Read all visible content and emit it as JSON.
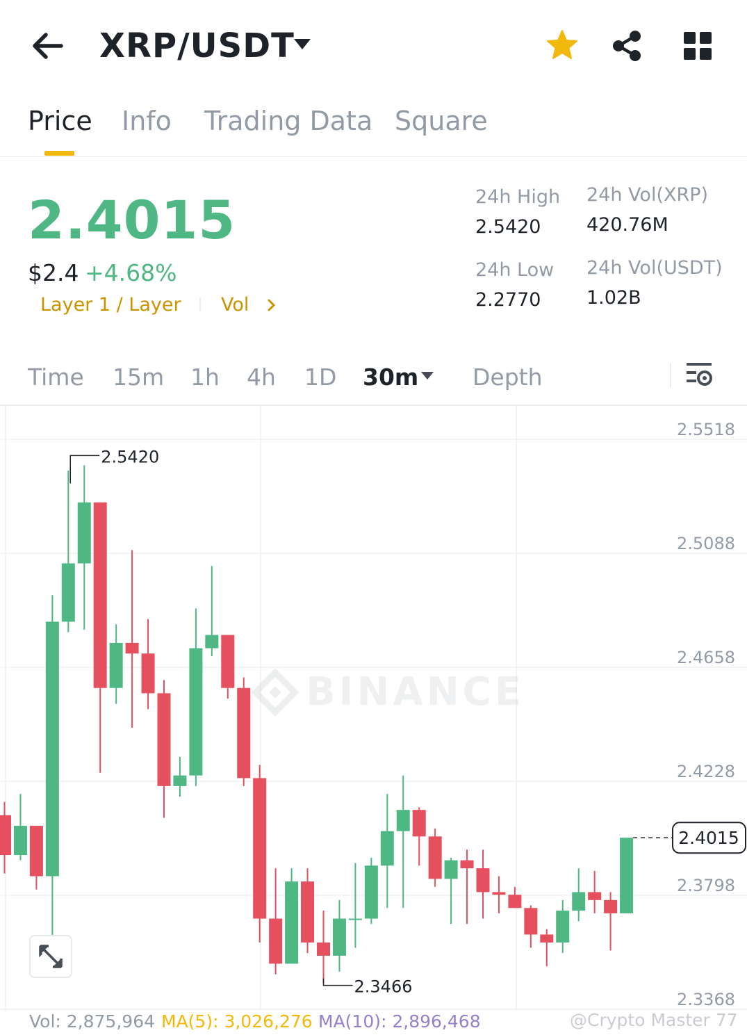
{
  "header": {
    "pair": "XRP/USDT",
    "icons": [
      "back-arrow-icon",
      "caret-down-icon",
      "star-icon",
      "share-icon",
      "grid-icon"
    ],
    "star_color": "#f0b90b"
  },
  "tabs": [
    {
      "label": "Price",
      "active": true
    },
    {
      "label": "Info",
      "active": false
    },
    {
      "label": "Trading Data",
      "active": false
    },
    {
      "label": "Square",
      "active": false
    }
  ],
  "price": {
    "last": "2.4015",
    "usd": "$2.4",
    "change": "+4.68%",
    "tag_layer": "Layer 1 / Layer",
    "tag_vol": "Vol",
    "up_color": "#4fb783",
    "down_color": "#e5505f",
    "tag_color": "#c99400"
  },
  "stats": {
    "high_label": "24h High",
    "high": "2.5420",
    "low_label": "24h Low",
    "low": "2.2770",
    "vol_xrp_label": "24h Vol(XRP)",
    "vol_xrp": "420.76M",
    "vol_usdt_label": "24h Vol(USDT)",
    "vol_usdt": "1.02B"
  },
  "intervals": [
    {
      "label": "Time",
      "active": false
    },
    {
      "label": "15m",
      "active": false
    },
    {
      "label": "1h",
      "active": false
    },
    {
      "label": "4h",
      "active": false
    },
    {
      "label": "1D",
      "active": false
    },
    {
      "label": "30m",
      "active": true
    },
    {
      "label": "Depth",
      "active": false
    }
  ],
  "chart_data": {
    "type": "candlestick",
    "y_ticks": [
      "2.5518",
      "2.5088",
      "2.4658",
      "2.4228",
      "2.3798",
      "2.3368"
    ],
    "ylim": [
      2.3368,
      2.5518
    ],
    "current_price": "2.4015",
    "annotation_high": "2.5420",
    "annotation_low": "2.3466",
    "watermark": "BINANCE",
    "candles": [
      {
        "o": 2.41,
        "h": 2.415,
        "l": 2.388,
        "c": 2.395
      },
      {
        "o": 2.395,
        "h": 2.418,
        "l": 2.393,
        "c": 2.406
      },
      {
        "o": 2.406,
        "h": 2.406,
        "l": 2.382,
        "c": 2.387
      },
      {
        "o": 2.387,
        "h": 2.493,
        "l": 2.357,
        "c": 2.483
      },
      {
        "o": 2.483,
        "h": 2.54,
        "l": 2.479,
        "c": 2.505
      },
      {
        "o": 2.505,
        "h": 2.542,
        "l": 2.48,
        "c": 2.528
      },
      {
        "o": 2.528,
        "h": 2.528,
        "l": 2.426,
        "c": 2.458
      },
      {
        "o": 2.458,
        "h": 2.482,
        "l": 2.452,
        "c": 2.475
      },
      {
        "o": 2.475,
        "h": 2.51,
        "l": 2.443,
        "c": 2.471
      },
      {
        "o": 2.471,
        "h": 2.484,
        "l": 2.45,
        "c": 2.456
      },
      {
        "o": 2.456,
        "h": 2.461,
        "l": 2.409,
        "c": 2.421
      },
      {
        "o": 2.421,
        "h": 2.432,
        "l": 2.417,
        "c": 2.425
      },
      {
        "o": 2.425,
        "h": 2.488,
        "l": 2.421,
        "c": 2.473
      },
      {
        "o": 2.473,
        "h": 2.504,
        "l": 2.47,
        "c": 2.478
      },
      {
        "o": 2.478,
        "h": 2.478,
        "l": 2.454,
        "c": 2.458
      },
      {
        "o": 2.458,
        "h": 2.462,
        "l": 2.421,
        "c": 2.424
      },
      {
        "o": 2.424,
        "h": 2.429,
        "l": 2.362,
        "c": 2.371
      },
      {
        "o": 2.371,
        "h": 2.39,
        "l": 2.35,
        "c": 2.354
      },
      {
        "o": 2.354,
        "h": 2.39,
        "l": 2.354,
        "c": 2.385
      },
      {
        "o": 2.385,
        "h": 2.39,
        "l": 2.358,
        "c": 2.362
      },
      {
        "o": 2.362,
        "h": 2.374,
        "l": 2.3466,
        "c": 2.357
      },
      {
        "o": 2.357,
        "h": 2.378,
        "l": 2.351,
        "c": 2.371
      },
      {
        "o": 2.371,
        "h": 2.392,
        "l": 2.36,
        "c": 2.371
      },
      {
        "o": 2.371,
        "h": 2.394,
        "l": 2.369,
        "c": 2.391
      },
      {
        "o": 2.391,
        "h": 2.418,
        "l": 2.375,
        "c": 2.404
      },
      {
        "o": 2.404,
        "h": 2.425,
        "l": 2.375,
        "c": 2.412
      },
      {
        "o": 2.412,
        "h": 2.413,
        "l": 2.391,
        "c": 2.402
      },
      {
        "o": 2.402,
        "h": 2.405,
        "l": 2.383,
        "c": 2.386
      },
      {
        "o": 2.386,
        "h": 2.394,
        "l": 2.369,
        "c": 2.393
      },
      {
        "o": 2.393,
        "h": 2.397,
        "l": 2.369,
        "c": 2.39
      },
      {
        "o": 2.39,
        "h": 2.397,
        "l": 2.371,
        "c": 2.381
      },
      {
        "o": 2.381,
        "h": 2.387,
        "l": 2.373,
        "c": 2.38
      },
      {
        "o": 2.38,
        "h": 2.383,
        "l": 2.375,
        "c": 2.375
      },
      {
        "o": 2.375,
        "h": 2.376,
        "l": 2.36,
        "c": 2.365
      },
      {
        "o": 2.365,
        "h": 2.367,
        "l": 2.353,
        "c": 2.362
      },
      {
        "o": 2.362,
        "h": 2.378,
        "l": 2.358,
        "c": 2.374
      },
      {
        "o": 2.374,
        "h": 2.39,
        "l": 2.37,
        "c": 2.381
      },
      {
        "o": 2.381,
        "h": 2.389,
        "l": 2.373,
        "c": 2.378
      },
      {
        "o": 2.378,
        "h": 2.381,
        "l": 2.359,
        "c": 2.373
      },
      {
        "o": 2.373,
        "h": 2.4015,
        "l": 2.373,
        "c": 2.4015
      }
    ]
  },
  "volume": {
    "vol": "Vol: 2,875,964",
    "ma5": "MA(5): 3,026,276",
    "ma10": "MA(10): 2,896,468",
    "vol_color": "#929aa5",
    "ma5_color": "#f0b90b",
    "ma10_color": "#9680c8"
  },
  "watermark_text": "@Crypto Master 77"
}
